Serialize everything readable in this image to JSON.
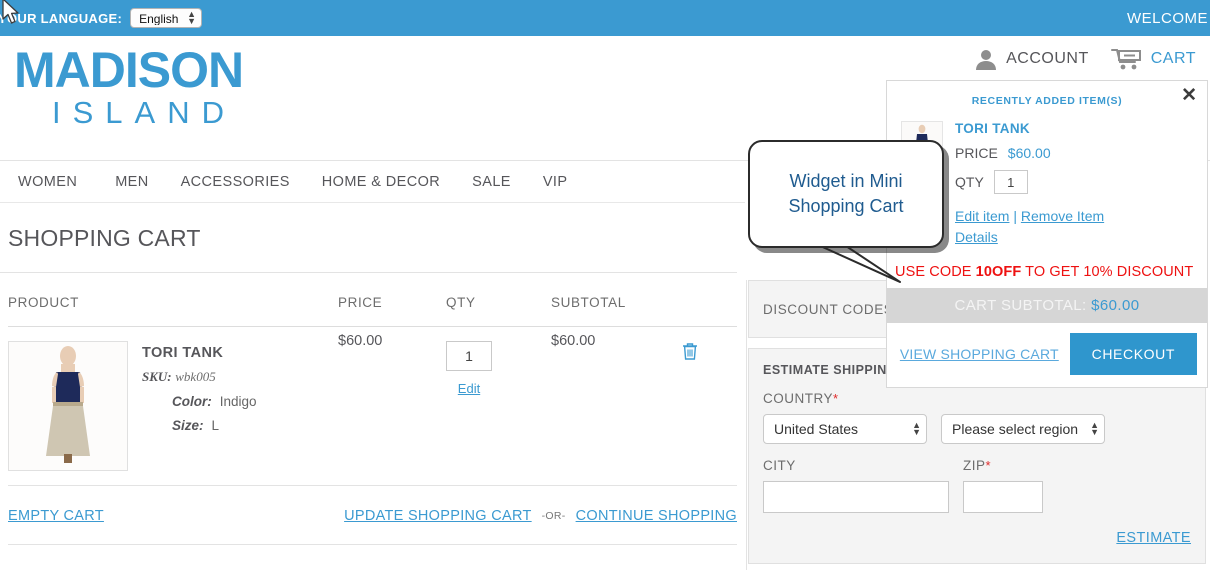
{
  "topbar": {
    "language_label": "YOUR LANGUAGE:",
    "language_value": "English",
    "welcome": "WELCOME"
  },
  "header": {
    "logo_main": "MADISON",
    "logo_sub": "ISLAND",
    "account_label": "ACCOUNT",
    "cart_label": "CART",
    "account_icon": "person-icon",
    "cart_icon": "shopping-cart-icon"
  },
  "nav": {
    "items": [
      {
        "label": "WOMEN"
      },
      {
        "label": "MEN"
      },
      {
        "label": "ACCESSORIES"
      },
      {
        "label": "HOME & DECOR"
      },
      {
        "label": "SALE"
      },
      {
        "label": "VIP"
      }
    ]
  },
  "page": {
    "title": "SHOPPING CART"
  },
  "cart_table": {
    "headers": {
      "product": "PRODUCT",
      "price": "PRICE",
      "qty": "QTY",
      "subtotal": "SUBTOTAL"
    },
    "rows": [
      {
        "name": "TORI TANK",
        "sku_label": "SKU:",
        "sku_value": "wbk005",
        "options": [
          {
            "label": "Color:",
            "value": "Indigo"
          },
          {
            "label": "Size:",
            "value": "L"
          }
        ],
        "price": "$60.00",
        "qty": "1",
        "edit_label": "Edit",
        "subtotal": "$60.00",
        "remove_icon": "trash-icon"
      }
    ]
  },
  "cart_actions": {
    "empty_cart": "EMPTY CART",
    "update_cart": "UPDATE SHOPPING CART",
    "or": "-OR-",
    "continue_shopping": "CONTINUE SHOPPING"
  },
  "discount": {
    "label": "DISCOUNT CODES",
    "input_value": ""
  },
  "shipping": {
    "title": "ESTIMATE SHIPPING AND TAX",
    "country_label": "COUNTRY",
    "country_value": "United States",
    "region_value": "Please select region, state or province",
    "city_label": "CITY",
    "city_value": "",
    "zip_label": "ZIP",
    "zip_value": "",
    "estimate_label": "ESTIMATE",
    "required_marker": "*"
  },
  "minicart": {
    "heading": "RECENTLY ADDED ITEM(S)",
    "close_icon": "close-icon",
    "item_name": "TORI TANK",
    "price_label": "PRICE",
    "price_value": "$60.00",
    "qty_label": "QTY",
    "qty_value": "1",
    "edit_item": "Edit item",
    "separator": "|",
    "remove_item": "Remove Item",
    "details": "Details",
    "promo_prefix": "USE CODE ",
    "promo_code": "10OFF",
    "promo_suffix": " TO GET 10% DISCOUNT",
    "subtotal_label": "CART SUBTOTAL:",
    "subtotal_value": "$60.00",
    "view_cart": "VIEW SHOPPING CART",
    "checkout": "CHECKOUT"
  },
  "callout": {
    "line1": "Widget in Mini",
    "line2": "Shopping Cart"
  },
  "colors": {
    "brand_blue": "#3b9ad1",
    "promo_red": "#ee1111",
    "subtotal_bar": "#d6d6d6",
    "panel_gray": "#f4f4f4"
  }
}
